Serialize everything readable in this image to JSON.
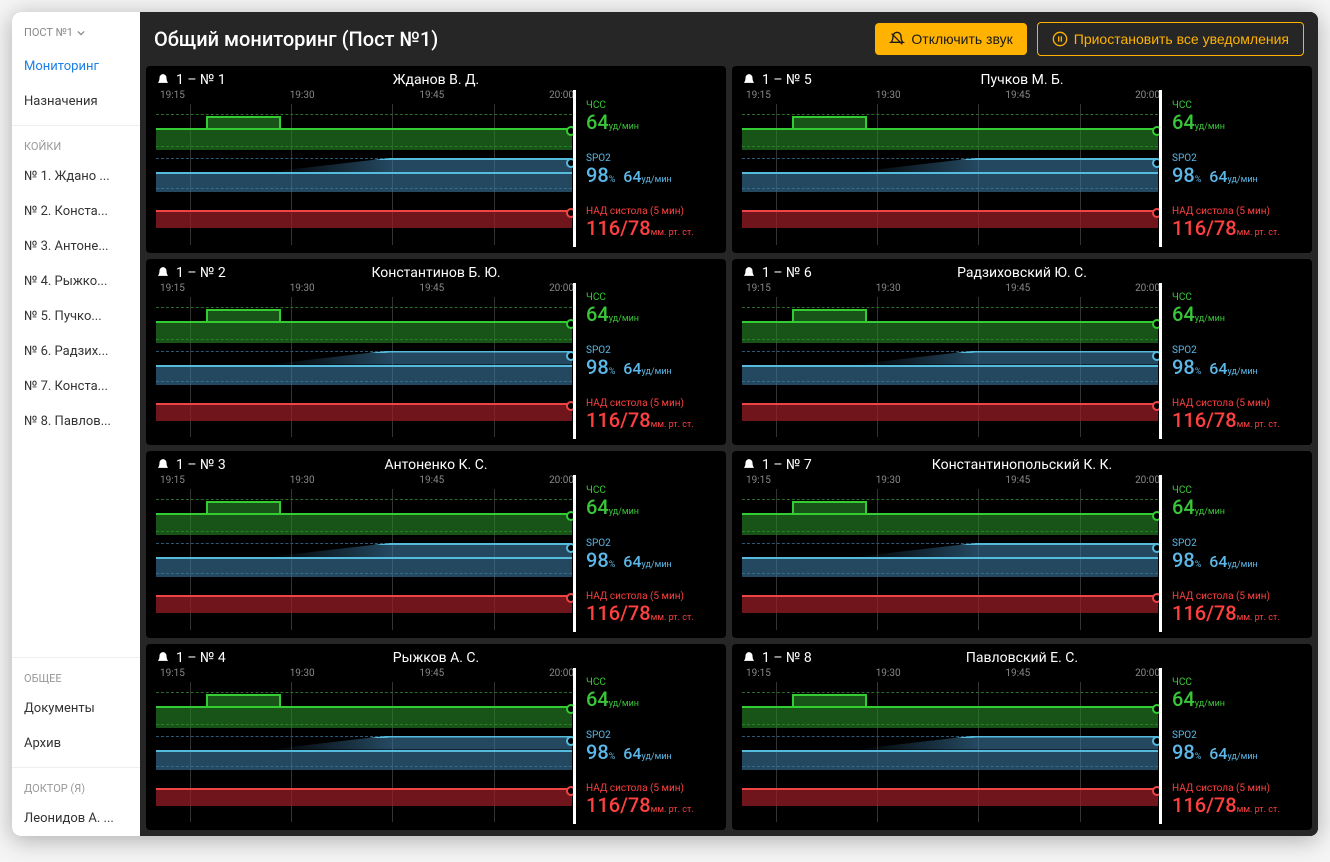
{
  "sidebar": {
    "post_selector": "ПОСТ №1",
    "nav": [
      {
        "label": "Мониторинг",
        "active": true
      },
      {
        "label": "Назначения",
        "active": false
      }
    ],
    "beds_header": "КОЙКИ",
    "beds": [
      "№ 1. Ждано ...",
      "№ 2. Конста...",
      "№ 3. Антоне...",
      "№ 4. Рыжко...",
      "№ 5. Пучко...",
      "№ 6. Радзих...",
      "№ 7. Конста...",
      "№ 8. Павлов..."
    ],
    "general_header": "ОБЩЕЕ",
    "general": [
      "Документы",
      "Архив"
    ],
    "doctor_header": "ДОКТОР (Я)",
    "doctor": "Леонидов А. ..."
  },
  "header": {
    "title": "Общий мониторинг (Пост №1)",
    "mute": "Отключить звук",
    "pause": "Приостановить все уведомления"
  },
  "time_ticks": [
    "19:15",
    "19:30",
    "19:45",
    "20:00"
  ],
  "colors": {
    "hr": "#39c639",
    "spo2": "#5bb8e8",
    "bp": "#ff4040",
    "accent": "#ffb300"
  },
  "metric_labels": {
    "hr": "ЧСС",
    "hr_unit": "уд/мин",
    "spo2": "SPO2",
    "spo2_pct": "%",
    "spo2_sec_unit": "уд/мин",
    "bp": "НАД систола (5 мин)",
    "bp_unit": "мм. рт. ст."
  },
  "cards": [
    {
      "bed": "1 – № 1",
      "patient": "Жданов В. Д.",
      "hr": 64,
      "spo2": 98,
      "spo2_secondary": 64,
      "bp_sys": 116,
      "bp_dia": 78
    },
    {
      "bed": "1 – № 5",
      "patient": "Пучков М. Б.",
      "hr": 64,
      "spo2": 98,
      "spo2_secondary": 64,
      "bp_sys": 116,
      "bp_dia": 78
    },
    {
      "bed": "1 – № 2",
      "patient": "Константинов Б. Ю.",
      "hr": 64,
      "spo2": 98,
      "spo2_secondary": 64,
      "bp_sys": 116,
      "bp_dia": 78
    },
    {
      "bed": "1 – № 6",
      "patient": "Радзиховский Ю. С.",
      "hr": 64,
      "spo2": 98,
      "spo2_secondary": 64,
      "bp_sys": 116,
      "bp_dia": 78
    },
    {
      "bed": "1 – № 3",
      "patient": "Антоненко К. С.",
      "hr": 64,
      "spo2": 98,
      "spo2_secondary": 64,
      "bp_sys": 116,
      "bp_dia": 78
    },
    {
      "bed": "1 – № 7",
      "patient": "Константинопольский К. К.",
      "hr": 64,
      "spo2": 98,
      "spo2_secondary": 64,
      "bp_sys": 116,
      "bp_dia": 78
    },
    {
      "bed": "1 – № 4",
      "patient": "Рыжков А. С.",
      "hr": 64,
      "spo2": 98,
      "spo2_secondary": 64,
      "bp_sys": 116,
      "bp_dia": 78
    },
    {
      "bed": "1 – № 8",
      "patient": "Павловский Е. С.",
      "hr": 64,
      "spo2": 98,
      "spo2_secondary": 64,
      "bp_sys": 116,
      "bp_dia": 78
    }
  ],
  "chart_data": {
    "type": "line",
    "note": "All 8 patient mini-panels show identical traces over the visible window.",
    "x_ticks": [
      "19:15",
      "19:30",
      "19:45",
      "20:00"
    ],
    "series": [
      {
        "name": "ЧСС (уд/мин)",
        "color": "#39c639",
        "approx_points": [
          [
            19.2,
            60
          ],
          [
            19.25,
            72
          ],
          [
            19.47,
            72
          ],
          [
            19.5,
            60
          ],
          [
            20.15,
            60
          ]
        ],
        "current": 64,
        "bounds_dashed": [
          55,
          75
        ]
      },
      {
        "name": "SPO2 (%)",
        "color": "#5bb8e8",
        "approx_points": [
          [
            19.2,
            94
          ],
          [
            19.47,
            94
          ],
          [
            19.6,
            97
          ],
          [
            19.9,
            98
          ],
          [
            20.15,
            98
          ]
        ],
        "current": 98,
        "secondary_value": 64,
        "bounds_dashed": [
          92,
          100
        ]
      },
      {
        "name": "НАД систола (5 мин) (мм. рт. ст.)",
        "color": "#ff4040",
        "approx_points": [
          [
            19.2,
            116
          ],
          [
            20.15,
            116
          ]
        ],
        "current": "116/78"
      }
    ]
  }
}
